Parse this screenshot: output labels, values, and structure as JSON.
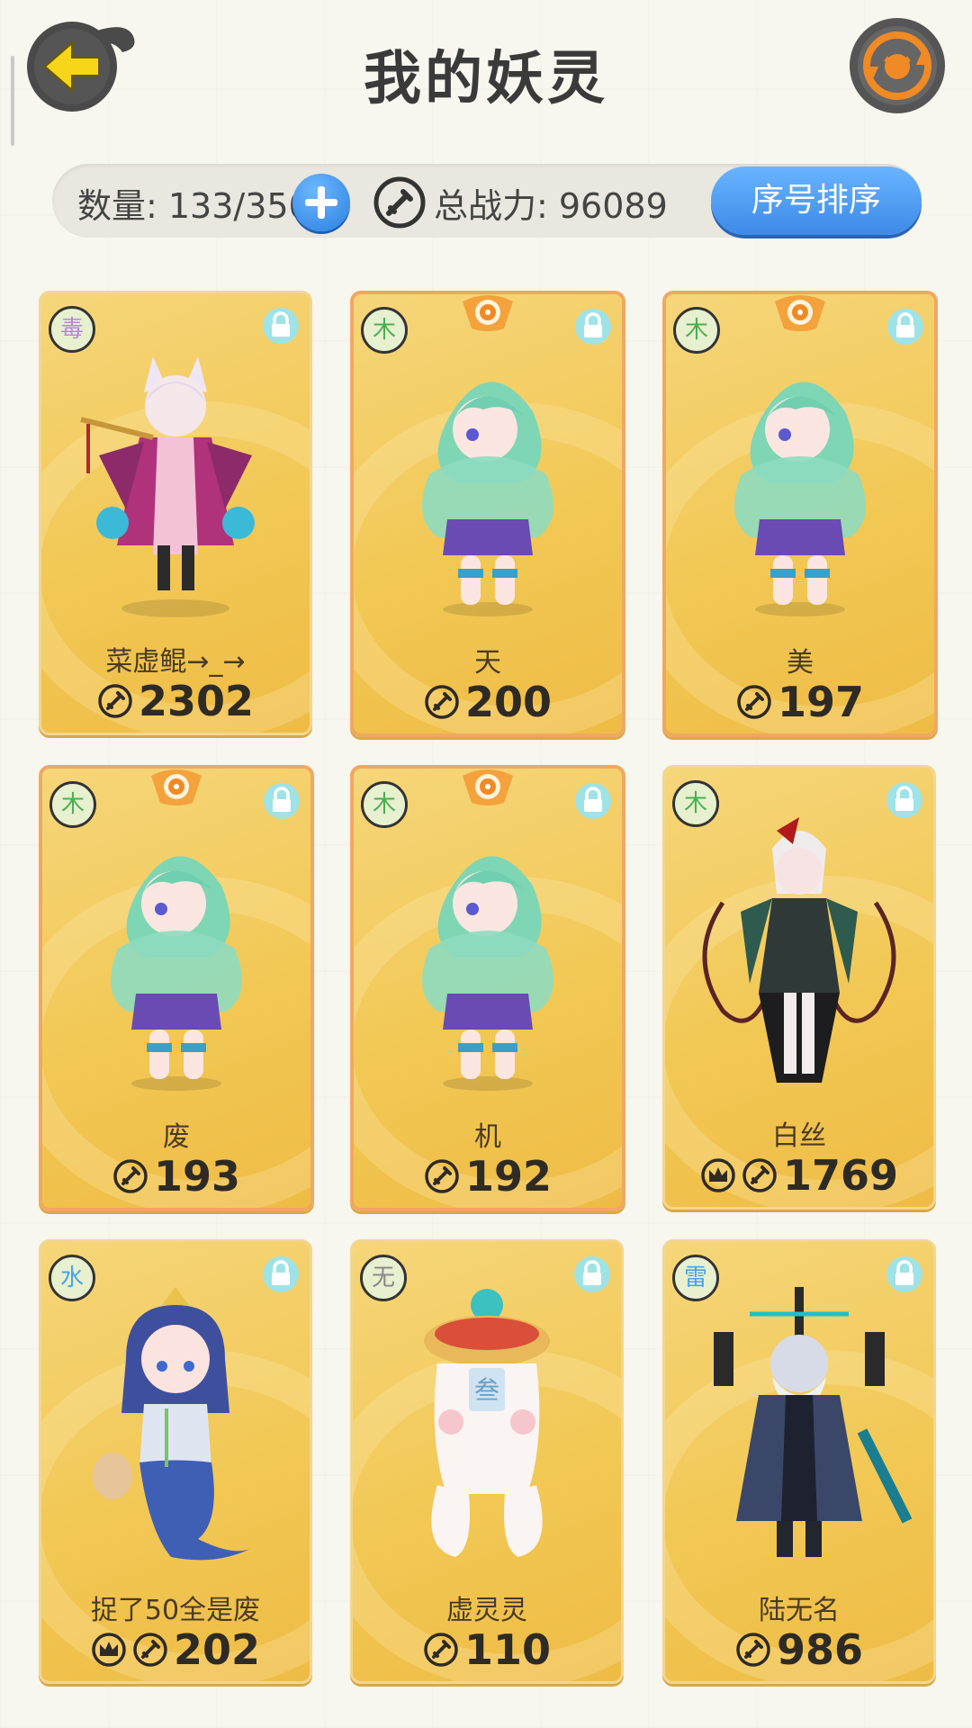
{
  "header": {
    "title": "我的妖灵"
  },
  "stats": {
    "count_label": "数量: 133/350",
    "power_label": "总战力: 96089",
    "sort_button": "序号排序"
  },
  "cards": [
    {
      "name": "菜虚鲲→_→",
      "power": "2302",
      "element": "毒",
      "element_color": "#b58ad9",
      "crest": false,
      "crown": false,
      "figure": "fox-spirit"
    },
    {
      "name": "天",
      "power": "200",
      "element": "木",
      "element_color": "#4caf50",
      "crest": true,
      "crown": false,
      "figure": "green-sprite"
    },
    {
      "name": "美",
      "power": "197",
      "element": "木",
      "element_color": "#4caf50",
      "crest": true,
      "crown": false,
      "figure": "green-sprite"
    },
    {
      "name": "废",
      "power": "193",
      "element": "木",
      "element_color": "#4caf50",
      "crest": true,
      "crown": false,
      "figure": "green-sprite"
    },
    {
      "name": "机",
      "power": "192",
      "element": "木",
      "element_color": "#4caf50",
      "crest": true,
      "crown": false,
      "figure": "green-sprite"
    },
    {
      "name": "白丝",
      "power": "1769",
      "element": "木",
      "element_color": "#4caf50",
      "crest": false,
      "crown": true,
      "figure": "vine-lady"
    },
    {
      "name": "捉了50全是废",
      "power": "202",
      "element": "水",
      "element_color": "#4aa3e8",
      "crest": false,
      "crown": true,
      "figure": "mermaid"
    },
    {
      "name": "虚灵灵",
      "power": "110",
      "element": "无",
      "element_color": "#888888",
      "crest": false,
      "crown": false,
      "figure": "urn-ghost"
    },
    {
      "name": "陆无名",
      "power": "986",
      "element": "雷",
      "element_color": "#4aa3e8",
      "crest": false,
      "crown": false,
      "figure": "dragon-sage"
    }
  ]
}
